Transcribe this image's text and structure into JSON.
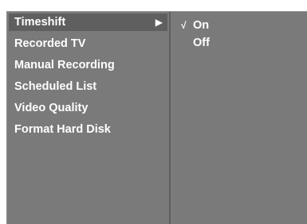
{
  "menu": {
    "items": [
      {
        "label": "Timeshift",
        "selected": true,
        "has_submenu": true
      },
      {
        "label": "Recorded TV"
      },
      {
        "label": "Manual Recording"
      },
      {
        "label": "Scheduled List"
      },
      {
        "label": "Video Quality"
      },
      {
        "label": "Format Hard Disk"
      }
    ],
    "submenu_arrow": "▶"
  },
  "submenu": {
    "options": [
      {
        "label": "On",
        "checked": true
      },
      {
        "label": "Off",
        "checked": false
      }
    ],
    "check_mark": "√"
  },
  "colors": {
    "panel": "#7a7a7a",
    "highlight": "#5f5f5f",
    "text": "#ffffff"
  },
  "icons": {
    "submenu_arrow": "triangle-right-icon",
    "check": "check-icon"
  }
}
